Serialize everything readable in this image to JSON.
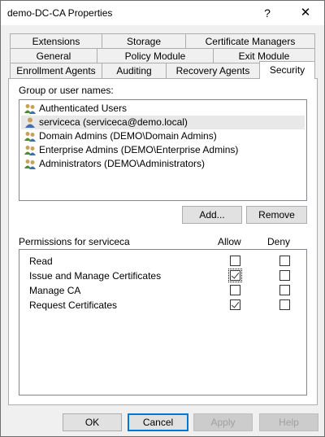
{
  "window": {
    "title": "demo-DC-CA Properties",
    "help_glyph": "?",
    "close_glyph": "✕"
  },
  "tabs_row1": [
    "Extensions",
    "Storage",
    "Certificate Managers"
  ],
  "tabs_row2": [
    "General",
    "Policy Module",
    "Exit Module"
  ],
  "tabs_row3": [
    "Enrollment Agents",
    "Auditing",
    "Recovery Agents",
    "Security"
  ],
  "active_tab": "Security",
  "security": {
    "group_label": "Group or user names:",
    "users": [
      {
        "name": "Authenticated Users",
        "icon": "group-icon",
        "selected": false
      },
      {
        "name": "serviceca (serviceca@demo.local)",
        "icon": "user-icon",
        "selected": true
      },
      {
        "name": "Domain Admins (DEMO\\Domain Admins)",
        "icon": "group-icon",
        "selected": false
      },
      {
        "name": "Enterprise Admins (DEMO\\Enterprise Admins)",
        "icon": "group-icon",
        "selected": false
      },
      {
        "name": "Administrators (DEMO\\Administrators)",
        "icon": "group-icon",
        "selected": false
      }
    ],
    "add_label": "Add...",
    "remove_label": "Remove",
    "permissions_label": "Permissions for serviceca",
    "allow_label": "Allow",
    "deny_label": "Deny",
    "permissions": [
      {
        "name": "Read",
        "allow": false,
        "deny": false
      },
      {
        "name": "Issue and Manage Certificates",
        "allow": true,
        "deny": false
      },
      {
        "name": "Manage CA",
        "allow": false,
        "deny": false
      },
      {
        "name": "Request Certificates",
        "allow": true,
        "deny": false
      }
    ]
  },
  "footer": {
    "ok_label": "OK",
    "cancel_label": "Cancel",
    "apply_label": "Apply",
    "help_label": "Help"
  },
  "colors": {
    "selection_bg": "#e8e8e8",
    "focus_border": "#0078d7"
  }
}
